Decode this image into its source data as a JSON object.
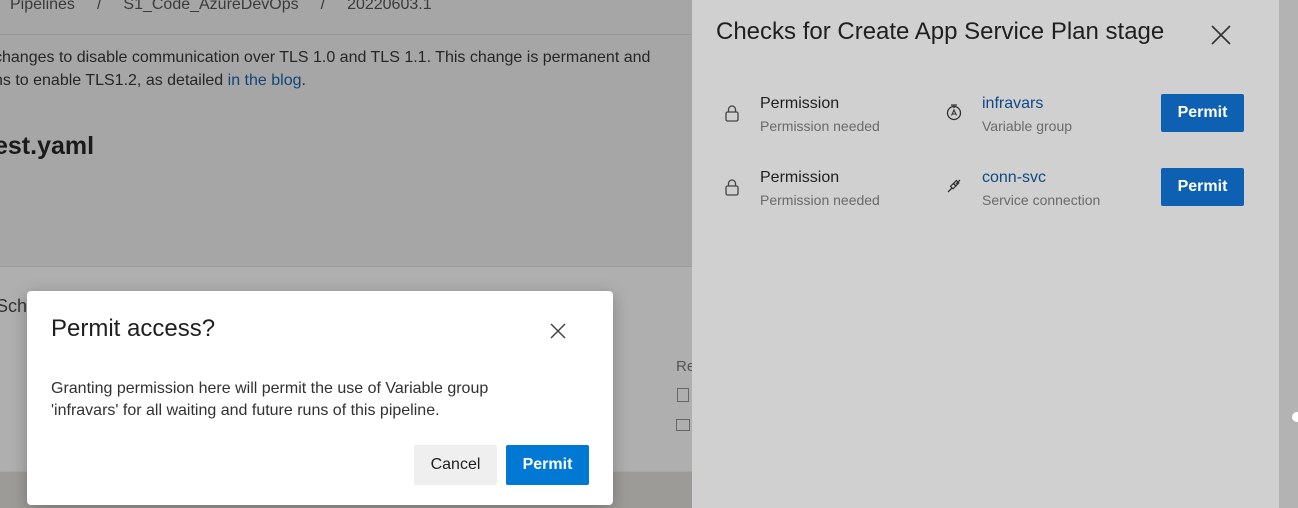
{
  "background": {
    "breadcrumb": [
      "Pipelines",
      "S1_Code_AzureDevOps",
      "20220603.1"
    ],
    "breadcrumb_separator": "/",
    "banner_line1": "changes to disable communication over TLS 1.0 and TLS 1.1. This change is permanent and",
    "banner_line2_prefix": "ns to enable TLS1.2, as detailed ",
    "banner_link": "in the blog",
    "banner_line2_suffix": ".",
    "page_title": "est.yaml",
    "card_text": "Sch",
    "card_side_text": "Re"
  },
  "panel": {
    "title": "Checks for Create App Service Plan stage",
    "checks": [
      {
        "kind": "Permission",
        "status": "Permission needed",
        "resource_name": "infravars",
        "resource_type": "Variable group",
        "resource_icon": "variable-group-icon",
        "button_label": "Permit"
      },
      {
        "kind": "Permission",
        "status": "Permission needed",
        "resource_name": "conn-svc",
        "resource_type": "Service connection",
        "resource_icon": "service-connection-icon",
        "button_label": "Permit"
      }
    ]
  },
  "dialog": {
    "title": "Permit access?",
    "body": "Granting permission here will permit the use of Variable group 'infravars' for all waiting and future runs of this pipeline.",
    "cancel_label": "Cancel",
    "permit_label": "Permit"
  },
  "colors": {
    "primary_button": "#0078d4",
    "panel_button": "#0e61b2",
    "link": "#0f4a85"
  }
}
